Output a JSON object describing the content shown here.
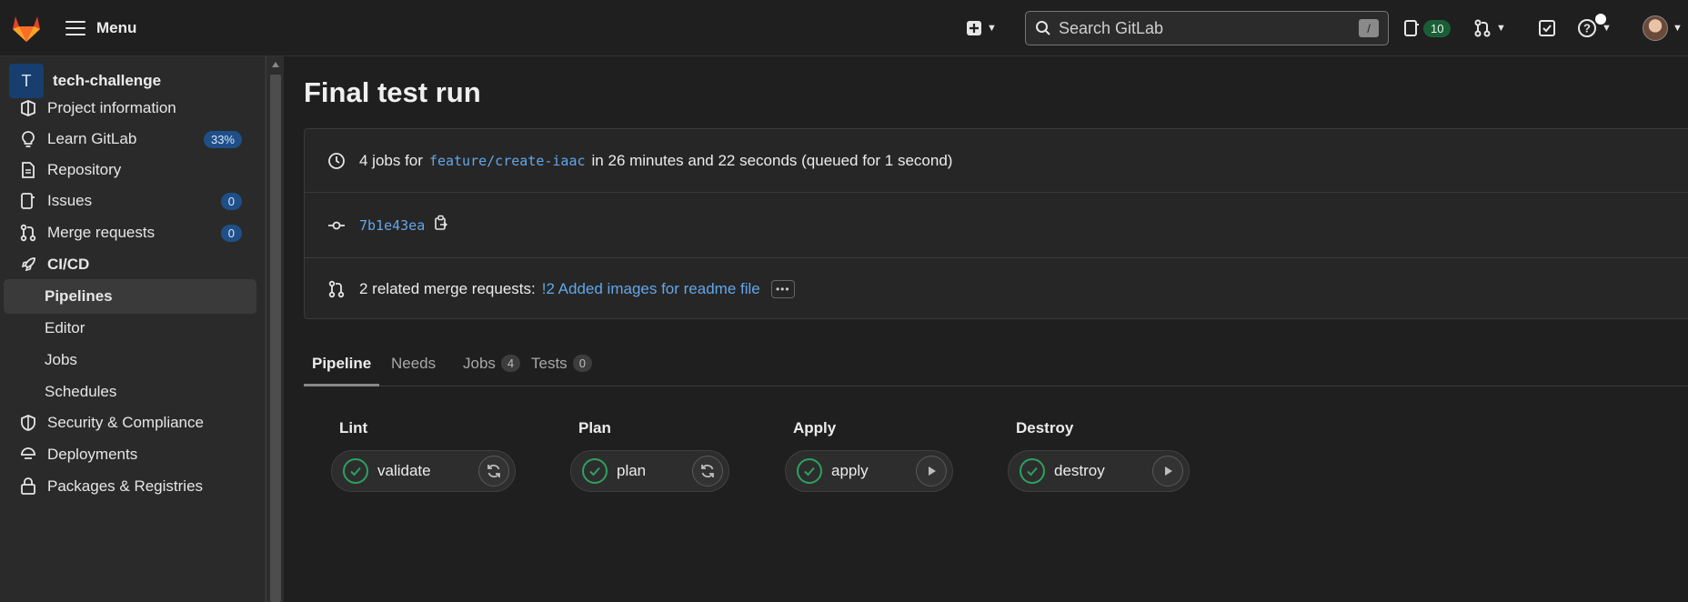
{
  "topbar": {
    "menu_label": "Menu",
    "search_placeholder": "Search GitLab",
    "search_shortcut": "/",
    "todo_count": "10"
  },
  "sidebar": {
    "project_initial": "T",
    "project_name": "tech-challenge",
    "items": [
      {
        "label": "Project information",
        "icon": "project-icon"
      },
      {
        "label": "Learn GitLab",
        "icon": "bulb-icon",
        "badge": "33%"
      },
      {
        "label": "Repository",
        "icon": "doc-icon"
      },
      {
        "label": "Issues",
        "icon": "issues-icon",
        "badge": "0"
      },
      {
        "label": "Merge requests",
        "icon": "merge-request-icon",
        "badge": "0"
      },
      {
        "label": "CI/CD",
        "icon": "rocket-icon"
      },
      {
        "label": "Pipelines"
      },
      {
        "label": "Editor"
      },
      {
        "label": "Jobs"
      },
      {
        "label": "Schedules"
      },
      {
        "label": "Security & Compliance",
        "icon": "shield-icon"
      },
      {
        "label": "Deployments",
        "icon": "deployments-icon"
      },
      {
        "label": "Packages & Registries",
        "icon": "package-icon"
      }
    ]
  },
  "pipeline": {
    "title": "Final test run",
    "summary_prefix": "4 jobs for",
    "branch": "feature/create-iaac",
    "summary_suffix": "in 26 minutes and 22 seconds (queued for 1 second)",
    "commit_sha": "7b1e43ea",
    "related_prefix": "2 related merge requests:",
    "related_link": "!2 Added images for readme file"
  },
  "tabs": [
    {
      "label": "Pipeline"
    },
    {
      "label": "Needs"
    },
    {
      "label": "Jobs",
      "count": "4"
    },
    {
      "label": "Tests",
      "count": "0"
    }
  ],
  "stages": [
    {
      "name": "Lint",
      "job": "validate",
      "action": "retry-icon"
    },
    {
      "name": "Plan",
      "job": "plan",
      "action": "retry-icon"
    },
    {
      "name": "Apply",
      "job": "apply",
      "action": "play-icon"
    },
    {
      "name": "Destroy",
      "job": "destroy",
      "action": "play-icon"
    }
  ],
  "colors": {
    "success": "#2da160",
    "link": "#63a6e9",
    "badge_blue": "#1f4f86",
    "todo_green": "#1a5e36"
  }
}
